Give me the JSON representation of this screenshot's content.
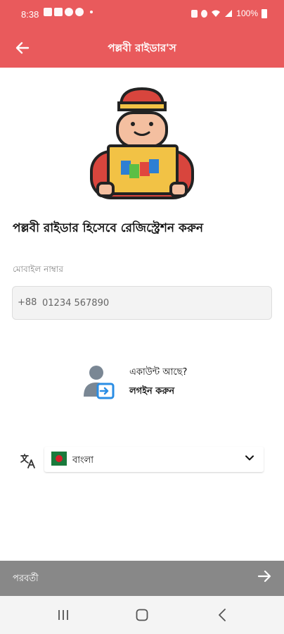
{
  "status_bar": {
    "time": "8:38",
    "battery": "100%"
  },
  "app_bar": {
    "title": "পল্লবী রাইডার'স"
  },
  "heading": "পল্লবী রাইডার হিসেবে রেজিস্ট্রেশন করুন",
  "phone_field": {
    "label": "মোবাইল নাম্বার",
    "prefix": "+88",
    "placeholder": "01234 567890"
  },
  "account": {
    "question": "একাউন্ট আছে?",
    "login": "লগইন করুন"
  },
  "language": {
    "selected": "বাংলা"
  },
  "bottom_bar": {
    "next_label": "পরবর্তী"
  },
  "colors": {
    "primary": "#e95a5c",
    "bottom_bar": "#888888",
    "text": "#111111"
  }
}
